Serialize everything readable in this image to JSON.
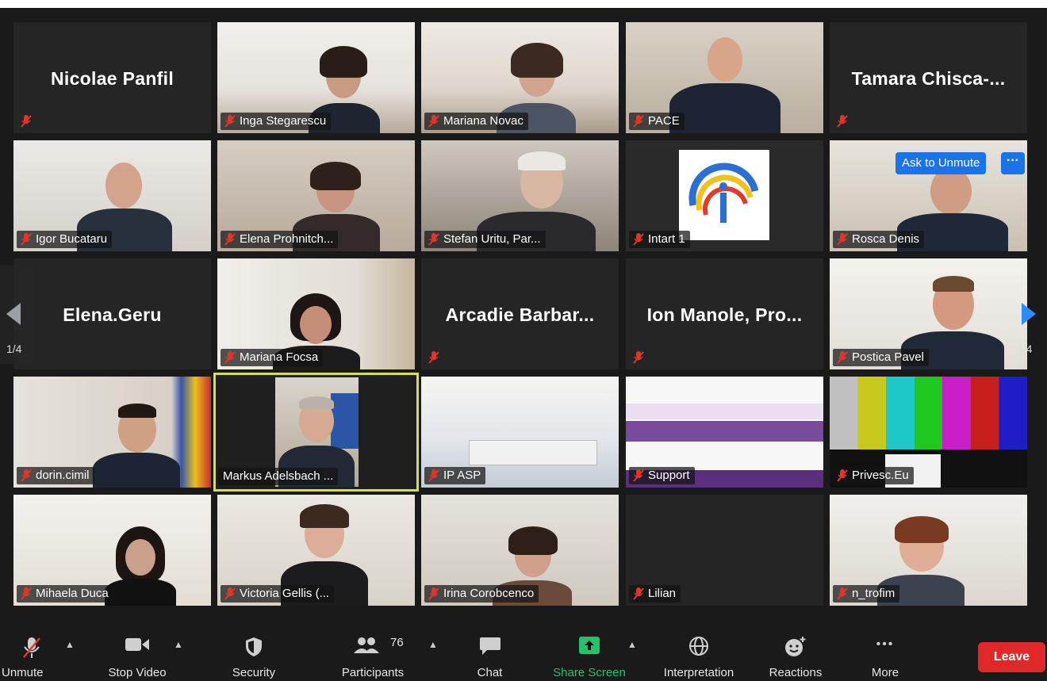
{
  "grid": {
    "page_indicator_left": "1/4",
    "page_indicator_right": "1/4",
    "ask_to_unmute": "Ask to Unmute",
    "tile_more": "···",
    "tiles": [
      {
        "name": "Nicolae Panfil",
        "video": false
      },
      {
        "name": "Inga Stegarescu",
        "video": true
      },
      {
        "name": "Mariana Novac",
        "video": true
      },
      {
        "name": "PACE",
        "video": true
      },
      {
        "name": "Tamara  Chisca-...",
        "video": false
      },
      {
        "name": "Igor Bucataru",
        "video": true
      },
      {
        "name": "Elena Prohnitch...",
        "video": true
      },
      {
        "name": "Stefan Uritu, Par...",
        "video": true
      },
      {
        "name": "Intart 1",
        "video": true
      },
      {
        "name": "Rosca Denis",
        "video": true
      },
      {
        "name": "Elena.Geru",
        "video": false
      },
      {
        "name": "Mariana Focsa",
        "video": true
      },
      {
        "name": "Arcadie  Barbar...",
        "video": false
      },
      {
        "name": "Ion Manole, Pro...",
        "video": false
      },
      {
        "name": "Postica Pavel",
        "video": true
      },
      {
        "name": "dorin.cimil",
        "video": true
      },
      {
        "name": "Markus Adelsbach ...",
        "video": true,
        "active": true
      },
      {
        "name": "IP ASP",
        "video": true
      },
      {
        "name": "Support",
        "video": true
      },
      {
        "name": "Privesc.Eu",
        "video": true
      },
      {
        "name": "Mihaela Duca",
        "video": true
      },
      {
        "name": "Victoria Gellis (...",
        "video": true
      },
      {
        "name": "Irina Corobcenco",
        "video": true
      },
      {
        "name": "Lilian",
        "video": false
      },
      {
        "name": "n_trofim",
        "video": true
      }
    ]
  },
  "toolbar": {
    "unmute": "Unmute",
    "stop_video": "Stop Video",
    "security": "Security",
    "participants": "Participants",
    "participants_count": "76",
    "chat": "Chat",
    "share_screen": "Share Screen",
    "interpretation": "Interpretation",
    "reactions": "Reactions",
    "more": "More",
    "more_dots": "•••",
    "leave": "Leave"
  },
  "colors": {
    "accent_blue": "#1a73e8",
    "share_green": "#26c26b",
    "leave_red": "#e02828",
    "active_speaker": "#d6e04f",
    "muted_red": "#e0352b"
  }
}
